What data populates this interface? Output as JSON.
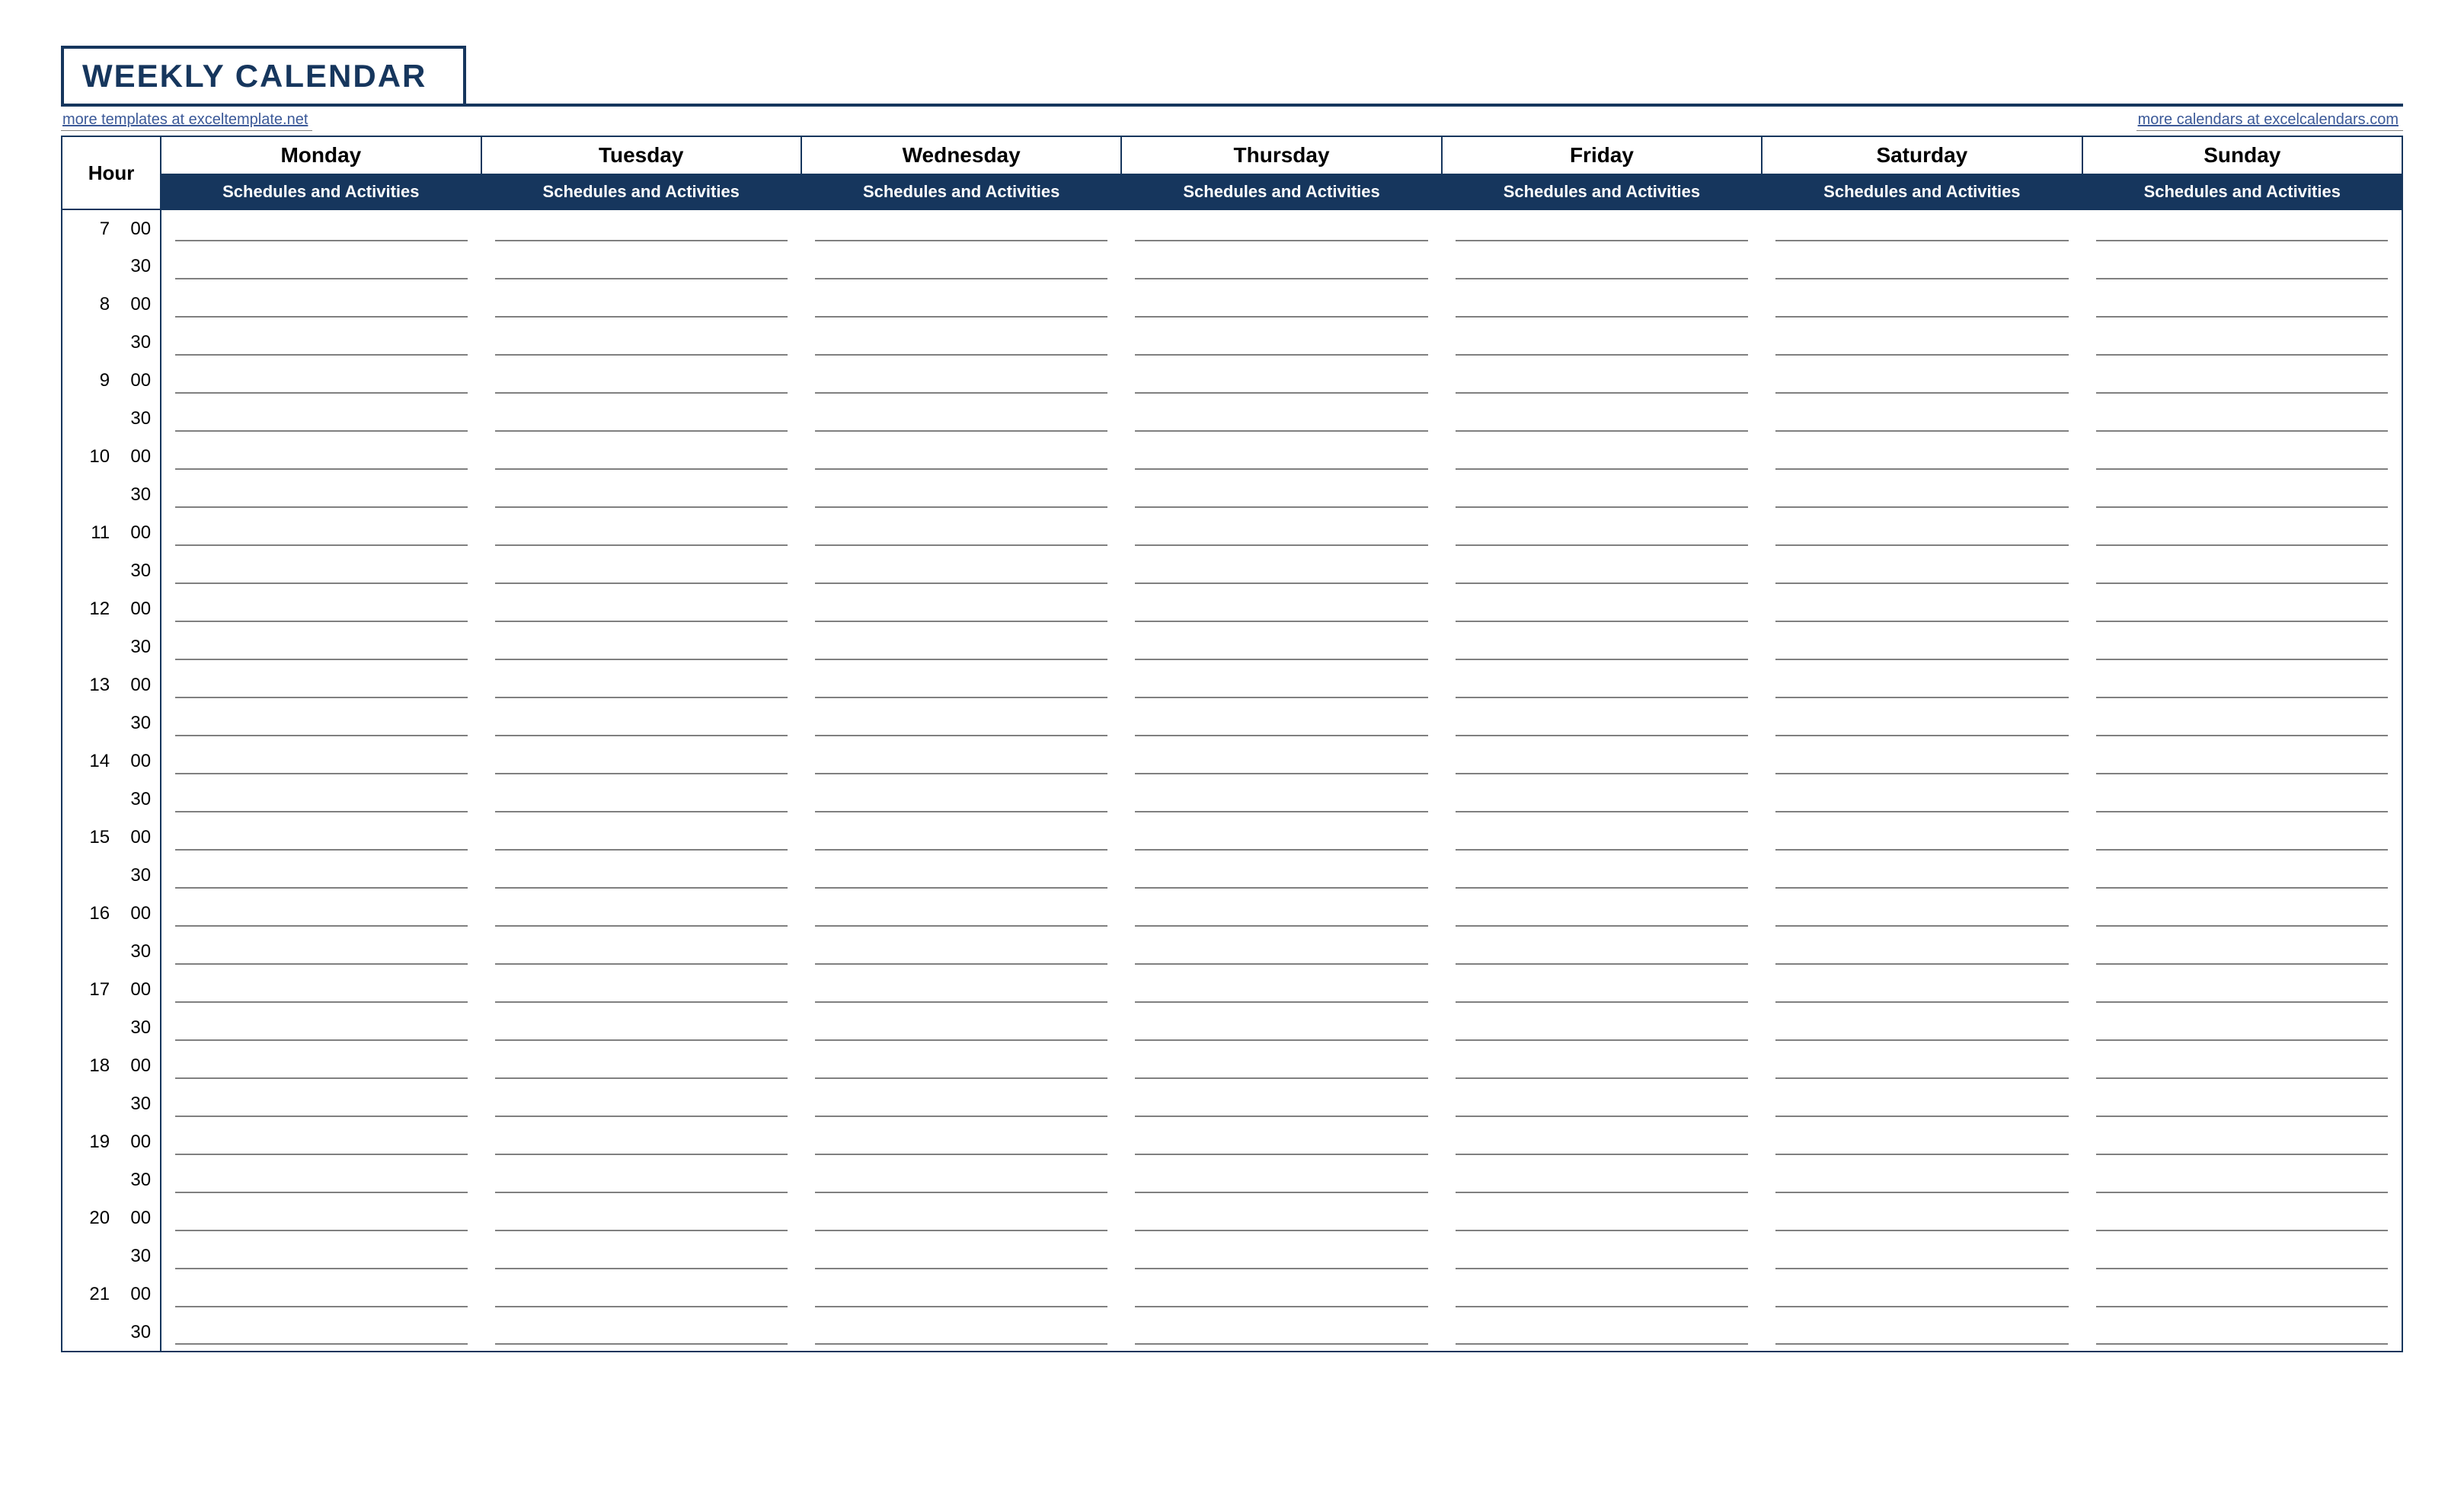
{
  "title": "WEEKLY CALENDAR",
  "links": {
    "left": "more templates at exceltemplate.net",
    "right": "more calendars at excelcalendars.com"
  },
  "hour_label": "Hour",
  "subheader": "Schedules and Activities",
  "days": [
    "Monday",
    "Tuesday",
    "Wednesday",
    "Thursday",
    "Friday",
    "Saturday",
    "Sunday"
  ],
  "time_rows": [
    {
      "hour": "7",
      "min": "00"
    },
    {
      "hour": "",
      "min": "30"
    },
    {
      "hour": "8",
      "min": "00"
    },
    {
      "hour": "",
      "min": "30"
    },
    {
      "hour": "9",
      "min": "00"
    },
    {
      "hour": "",
      "min": "30"
    },
    {
      "hour": "10",
      "min": "00"
    },
    {
      "hour": "",
      "min": "30"
    },
    {
      "hour": "11",
      "min": "00"
    },
    {
      "hour": "",
      "min": "30"
    },
    {
      "hour": "12",
      "min": "00"
    },
    {
      "hour": "",
      "min": "30"
    },
    {
      "hour": "13",
      "min": "00"
    },
    {
      "hour": "",
      "min": "30"
    },
    {
      "hour": "14",
      "min": "00"
    },
    {
      "hour": "",
      "min": "30"
    },
    {
      "hour": "15",
      "min": "00"
    },
    {
      "hour": "",
      "min": "30"
    },
    {
      "hour": "16",
      "min": "00"
    },
    {
      "hour": "",
      "min": "30"
    },
    {
      "hour": "17",
      "min": "00"
    },
    {
      "hour": "",
      "min": "30"
    },
    {
      "hour": "18",
      "min": "00"
    },
    {
      "hour": "",
      "min": "30"
    },
    {
      "hour": "19",
      "min": "00"
    },
    {
      "hour": "",
      "min": "30"
    },
    {
      "hour": "20",
      "min": "00"
    },
    {
      "hour": "",
      "min": "30"
    },
    {
      "hour": "21",
      "min": "00"
    },
    {
      "hour": "",
      "min": "30"
    }
  ]
}
